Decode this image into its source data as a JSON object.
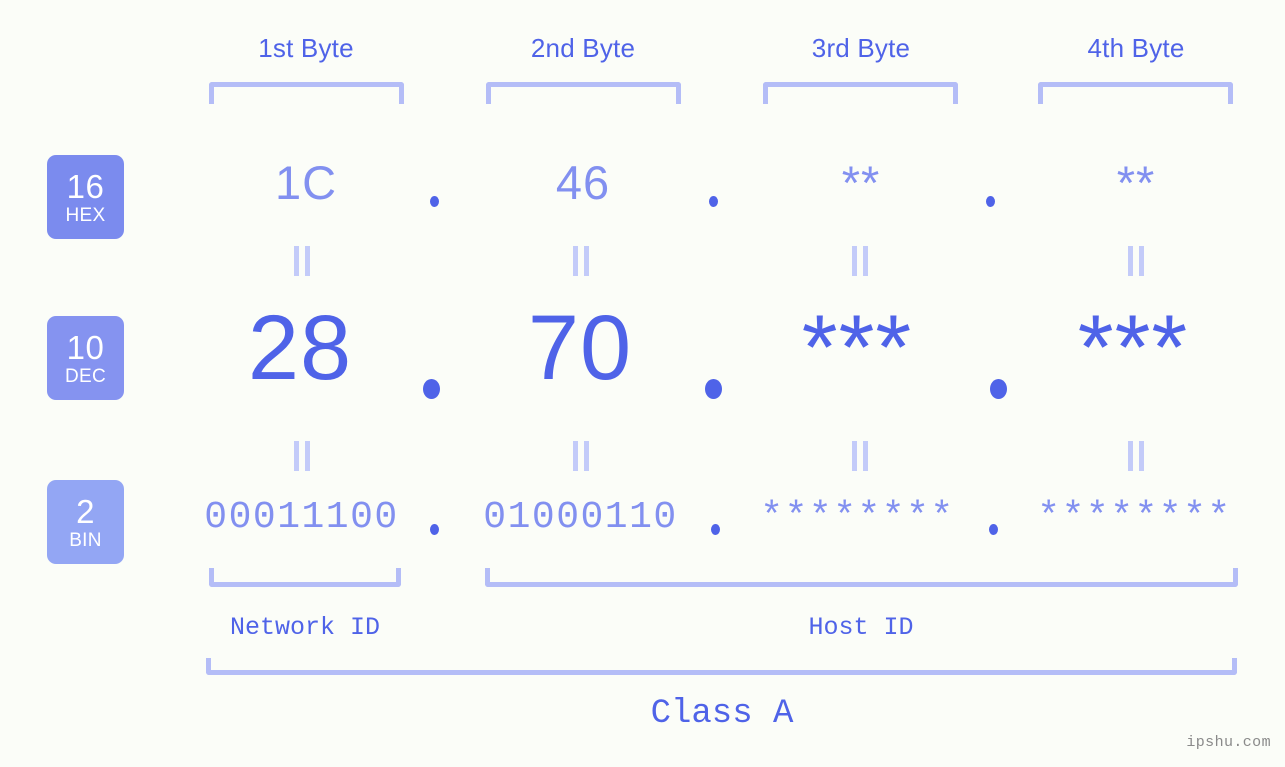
{
  "page": {
    "background_color": "#fbfdf8",
    "accent_color": "#4f63e8",
    "accent_light_color": "#8290f0",
    "bracket_color": "#b4bdf7",
    "watermark": "ipshu.com"
  },
  "byte_headers": [
    {
      "label": "1st Byte"
    },
    {
      "label": "2nd Byte"
    },
    {
      "label": "3rd Byte"
    },
    {
      "label": "4th Byte"
    }
  ],
  "bases": [
    {
      "number": "16",
      "name": "HEX",
      "color": "#7b8bee"
    },
    {
      "number": "10",
      "name": "DEC",
      "color": "#8593f0"
    },
    {
      "number": "2",
      "name": "BIN",
      "color": "#93a6f4"
    }
  ],
  "rows": {
    "hex": {
      "base_number": "16",
      "base_name": "HEX",
      "values": [
        "1C",
        "46",
        "**",
        "**"
      ],
      "separator": "."
    },
    "dec": {
      "base_number": "10",
      "base_name": "DEC",
      "values": [
        "28",
        "70",
        "***",
        "***"
      ],
      "separator": "."
    },
    "bin": {
      "base_number": "2",
      "base_name": "BIN",
      "values": [
        "00011100",
        "01000110",
        "********",
        "********"
      ],
      "separator": "."
    }
  },
  "equivalence_mark": "||",
  "segments": {
    "network_id": "Network ID",
    "host_id": "Host ID",
    "class": "Class A"
  }
}
